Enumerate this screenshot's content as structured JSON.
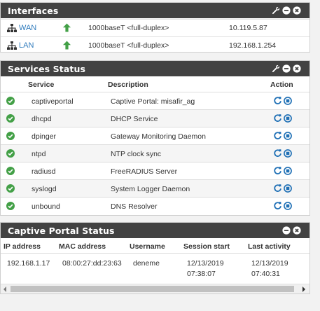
{
  "interfaces": {
    "title": "Interfaces",
    "rows": [
      {
        "name": "WAN",
        "media": "1000baseT <full-duplex>",
        "ip": "10.119.5.87"
      },
      {
        "name": "LAN",
        "media": "1000baseT <full-duplex>",
        "ip": "192.168.1.254"
      }
    ]
  },
  "services": {
    "title": "Services Status",
    "columns": {
      "service": "Service",
      "description": "Description",
      "action": "Action"
    },
    "rows": [
      {
        "name": "captiveportal",
        "description": "Captive Portal: misafir_ag"
      },
      {
        "name": "dhcpd",
        "description": "DHCP Service"
      },
      {
        "name": "dpinger",
        "description": "Gateway Monitoring Daemon"
      },
      {
        "name": "ntpd",
        "description": "NTP clock sync"
      },
      {
        "name": "radiusd",
        "description": "FreeRADIUS Server"
      },
      {
        "name": "syslogd",
        "description": "System Logger Daemon"
      },
      {
        "name": "unbound",
        "description": "DNS Resolver"
      }
    ]
  },
  "captive": {
    "title": "Captive Portal Status",
    "columns": {
      "ip": "IP address",
      "mac": "MAC address",
      "user": "Username",
      "start": "Session start",
      "last": "Last activity"
    },
    "rows": [
      {
        "ip": "192.168.1.17",
        "mac": "08:00:27:dd:23:63",
        "user": "deneme",
        "start_date": "12/13/2019",
        "start_time": "07:38:07",
        "last_date": "12/13/2019",
        "last_time": "07:40:31"
      }
    ]
  },
  "colors": {
    "header_bg": "#424242",
    "link": "#317cbd",
    "status_ok": "#43a047",
    "action": "#1e6fb5"
  },
  "icons": {
    "settings": "wrench-icon",
    "collapse": "minus-circle-icon",
    "close": "close-circle-icon",
    "interface": "network-icon",
    "link_up": "arrow-up-icon",
    "running": "check-circle-icon",
    "restart": "restart-icon",
    "stop": "stop-circle-icon"
  }
}
